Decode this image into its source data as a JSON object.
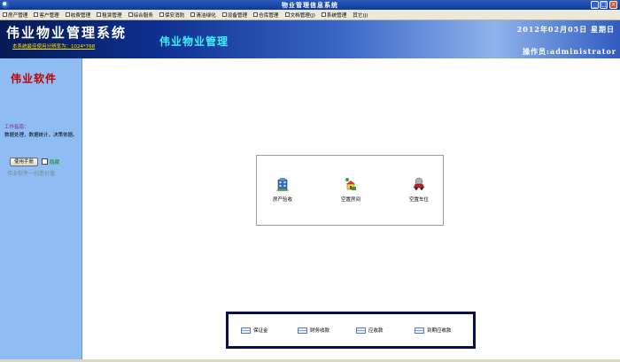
{
  "window": {
    "title": "物业管理信息系统",
    "controls": {
      "minimize": "_",
      "maximize": "□",
      "close": "×"
    }
  },
  "menu": [
    {
      "label": "房产管理",
      "icon": "menu-icon"
    },
    {
      "label": "客户管理",
      "icon": "menu-icon"
    },
    {
      "label": "收费管理",
      "icon": "menu-icon"
    },
    {
      "label": "租赁管理",
      "icon": "menu-icon"
    },
    {
      "label": "综合服务",
      "icon": "menu-icon"
    },
    {
      "label": "保安消防",
      "icon": "menu-icon"
    },
    {
      "label": "清洁绿化",
      "icon": "menu-icon"
    },
    {
      "label": "设备管理",
      "icon": "menu-icon"
    },
    {
      "label": "仓库管理",
      "icon": "menu-icon"
    },
    {
      "label": "文档管理(J)",
      "icon": "menu-icon"
    },
    {
      "label": "系统管理",
      "icon": "menu-icon"
    },
    {
      "label": "其它(J)",
      "icon": ""
    }
  ],
  "header": {
    "system_title": "伟业物业管理系统",
    "resolution_note": "本系统最佳使用分辨率为：1024*768",
    "sub_title": "伟业物业管理",
    "date": "2012年02月05日  星期日",
    "operator": "操作员:administrator"
  },
  "sidebar": {
    "brand": "伟业软件",
    "work_label": "工作指南：",
    "work_text": "数据处理，数据统计，决策依据。",
    "manual_button": "使用手册",
    "hide_label": "隐藏",
    "slogan": "伟业软件一创造价值"
  },
  "shortcuts": [
    {
      "label": "房产验收",
      "icon": "building-icon"
    },
    {
      "label": "空置房间",
      "icon": "vacant-room-icon"
    },
    {
      "label": "空置车位",
      "icon": "parking-car-icon"
    }
  ],
  "finance": [
    {
      "label": "保证金",
      "icon": "card-icon"
    },
    {
      "label": "财务收款",
      "icon": "card-icon"
    },
    {
      "label": "应收款",
      "icon": "card-icon"
    },
    {
      "label": "到期应收款",
      "icon": "card-icon"
    }
  ],
  "colors": {
    "titlebar": "#0c3b9e",
    "sidebar": "#8ebcf3",
    "brand_red": "#c00000",
    "subtitle_cyan": "#3ff0ff",
    "finance_border": "#0a0f48"
  }
}
